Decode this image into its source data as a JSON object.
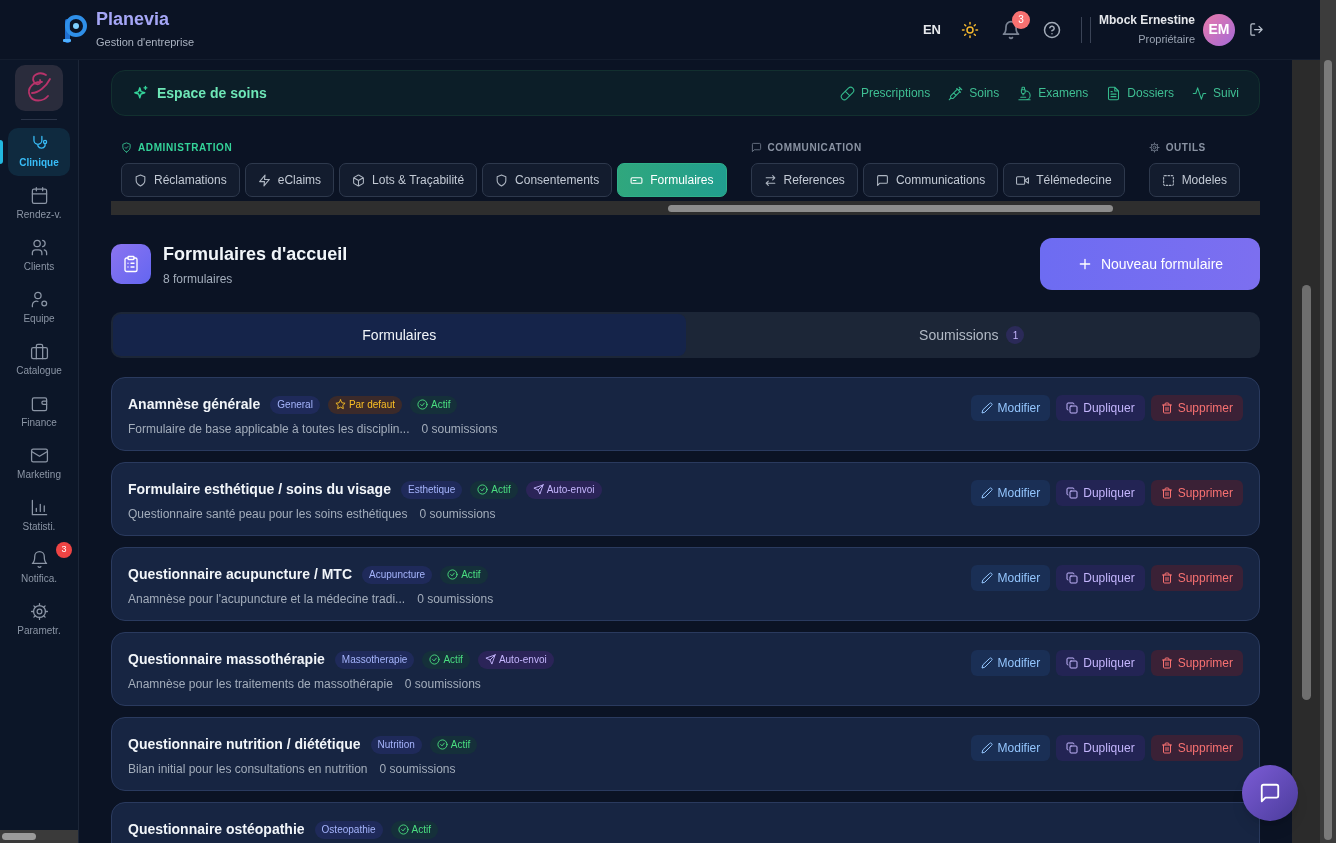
{
  "header": {
    "app_name": "Planevia",
    "app_subtitle": "Gestion d'entreprise",
    "language": "EN",
    "notification_count": "3",
    "user_name": "Mbock Ernestine",
    "user_role": "Propriétaire",
    "avatar_initials": "EM"
  },
  "sidebar": {
    "items": [
      {
        "label": "Clinique",
        "selected": true
      },
      {
        "label": "Rendez-v.",
        "selected": false
      },
      {
        "label": "Clients",
        "selected": false
      },
      {
        "label": "Equipe",
        "selected": false
      },
      {
        "label": "Catalogue",
        "selected": false
      },
      {
        "label": "Finance",
        "selected": false
      },
      {
        "label": "Marketing",
        "selected": false
      },
      {
        "label": "Statisti.",
        "selected": false
      },
      {
        "label": "Notifica.",
        "selected": false,
        "badge": "3"
      },
      {
        "label": "Parametr.",
        "selected": false
      }
    ]
  },
  "module_bar": {
    "title": "Espace de soins",
    "links": [
      "Prescriptions",
      "Soins",
      "Examens",
      "Dossiers",
      "Suivi"
    ]
  },
  "tab_groups": [
    {
      "heading": "ADMINISTRATION",
      "tabs": [
        {
          "label": "Réclamations",
          "selected": false
        },
        {
          "label": "eClaims",
          "selected": false
        },
        {
          "label": "Lots & Traçabilité",
          "selected": false
        },
        {
          "label": "Consentements",
          "selected": false
        },
        {
          "label": "Formulaires",
          "selected": true
        }
      ]
    },
    {
      "heading": "COMMUNICATION",
      "tabs": [
        {
          "label": "References",
          "selected": false
        },
        {
          "label": "Communications",
          "selected": false
        },
        {
          "label": "Télémedecine",
          "selected": false
        }
      ]
    },
    {
      "heading": "OUTILS",
      "tabs": [
        {
          "label": "Modeles",
          "selected": false
        }
      ]
    }
  ],
  "page": {
    "title": "Formulaires d'accueil",
    "count": "8 formulaires",
    "new_button": "Nouveau formulaire"
  },
  "view_tabs": [
    {
      "label": "Formulaires",
      "selected": true
    },
    {
      "label": "Soumissions",
      "selected": false,
      "count": "1"
    }
  ],
  "forms": [
    {
      "title": "Anamnèse générale",
      "badges": [
        {
          "kind": "category",
          "label": "General"
        },
        {
          "kind": "default",
          "label": "Par defaut"
        },
        {
          "kind": "active",
          "label": "Actif"
        }
      ],
      "description": "Formulaire de base applicable à toutes les disciplin...",
      "submissions": "0 soumissions",
      "actions": [
        "Modifier",
        "Dupliquer",
        "Supprimer"
      ]
    },
    {
      "title": "Formulaire esthétique / soins du visage",
      "badges": [
        {
          "kind": "category",
          "label": "Esthetique"
        },
        {
          "kind": "active",
          "label": "Actif"
        },
        {
          "kind": "auto_send",
          "label": "Auto-envoi"
        }
      ],
      "description": "Questionnaire santé peau pour les soins esthétiques",
      "submissions": "0 soumissions",
      "actions": [
        "Modifier",
        "Dupliquer",
        "Supprimer"
      ]
    },
    {
      "title": "Questionnaire acupuncture / MTC",
      "badges": [
        {
          "kind": "category",
          "label": "Acupuncture"
        },
        {
          "kind": "active",
          "label": "Actif"
        }
      ],
      "description": "Anamnèse pour l'acupuncture et la médecine tradi...",
      "submissions": "0 soumissions",
      "actions": [
        "Modifier",
        "Dupliquer",
        "Supprimer"
      ]
    },
    {
      "title": "Questionnaire massothérapie",
      "badges": [
        {
          "kind": "category",
          "label": "Massotherapie"
        },
        {
          "kind": "active",
          "label": "Actif"
        },
        {
          "kind": "auto_send",
          "label": "Auto-envoi"
        }
      ],
      "description": "Anamnèse pour les traitements de massothérapie",
      "submissions": "0 soumissions",
      "actions": [
        "Modifier",
        "Dupliquer",
        "Supprimer"
      ]
    },
    {
      "title": "Questionnaire nutrition / diététique",
      "badges": [
        {
          "kind": "category",
          "label": "Nutrition"
        },
        {
          "kind": "active",
          "label": "Actif"
        }
      ],
      "description": "Bilan initial pour les consultations en nutrition",
      "submissions": "0 soumissions",
      "actions": [
        "Modifier",
        "Dupliquer",
        "Supprimer"
      ]
    },
    {
      "title": "Questionnaire ostéopathie",
      "badges": [
        {
          "kind": "category",
          "label": "Osteopathie"
        },
        {
          "kind": "active",
          "label": "Actif"
        }
      ]
    }
  ]
}
